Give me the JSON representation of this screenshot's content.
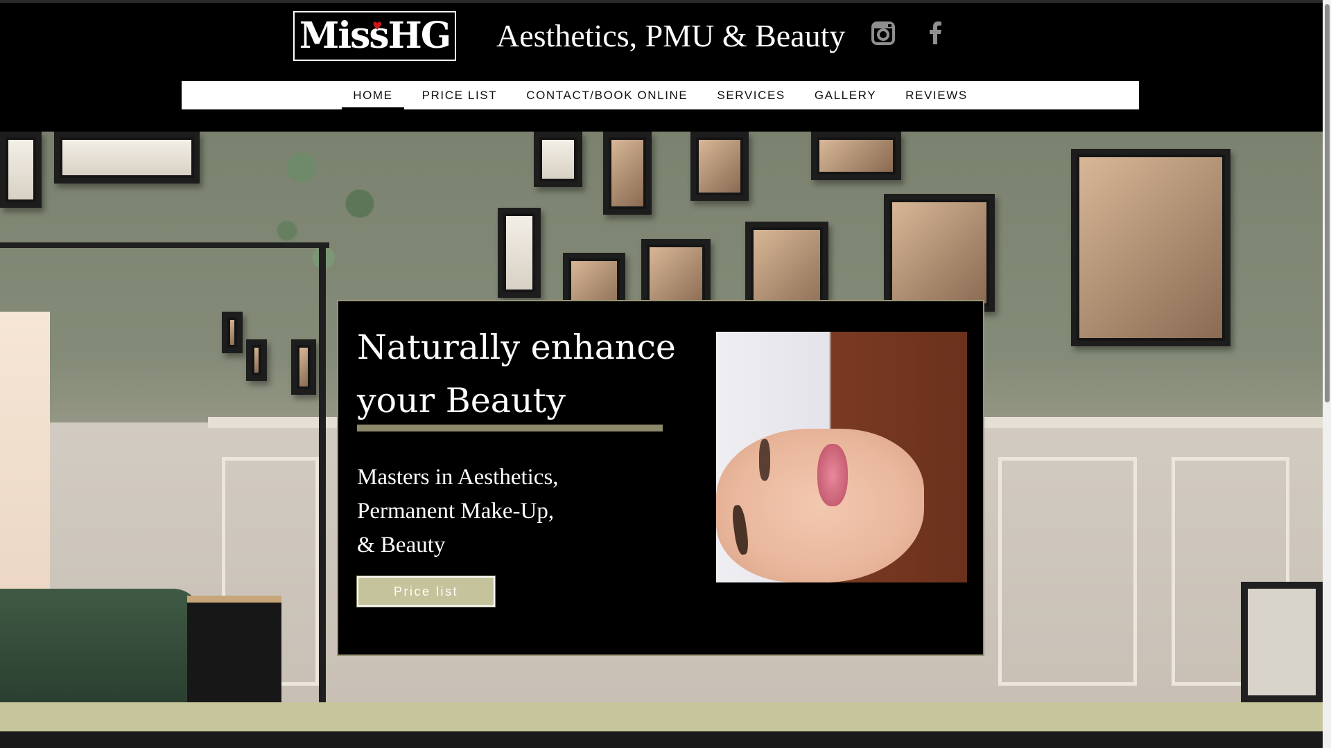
{
  "header": {
    "logo_text": "MissHG",
    "tagline": "Aesthetics, PMU & Beauty",
    "social": [
      {
        "name": "instagram-icon"
      },
      {
        "name": "facebook-icon"
      }
    ]
  },
  "nav": {
    "items": [
      {
        "label": "HOME",
        "active": true
      },
      {
        "label": "PRICE LIST",
        "active": false
      },
      {
        "label": "CONTACT/BOOK ONLINE",
        "active": false
      },
      {
        "label": "SERVICES",
        "active": false
      },
      {
        "label": "GALLERY",
        "active": false
      },
      {
        "label": "REVIEWS",
        "active": false
      }
    ]
  },
  "hero": {
    "heading": "Naturally enhance your Beauty",
    "sub_lines": [
      "Masters in Aesthetics,",
      "Permanent Make-Up,",
      "& Beauty"
    ],
    "cta_label": "Price list"
  },
  "colors": {
    "accent_olive": "#8c8a6b",
    "button_fill": "#c4c39b",
    "strip": "#c7c59c",
    "header_bg": "#000000"
  }
}
